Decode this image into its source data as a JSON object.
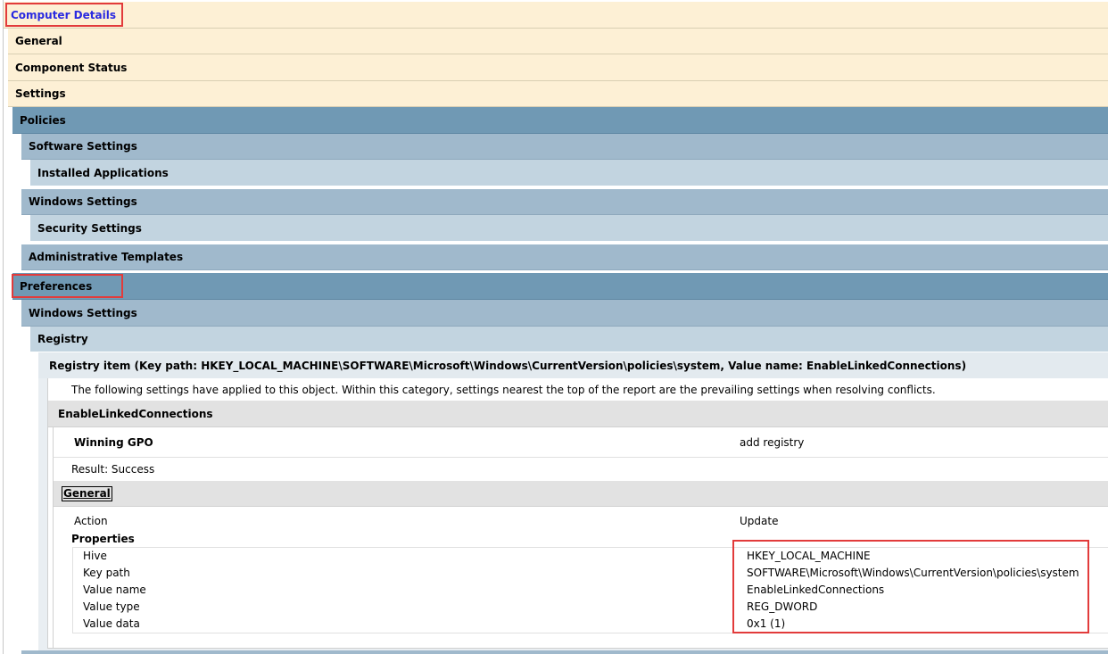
{
  "header": {
    "title": "Computer Details"
  },
  "sections": {
    "general": "General",
    "component_status": "Component Status",
    "settings": "Settings",
    "policies": "Policies",
    "software_settings": "Software Settings",
    "installed_applications": "Installed Applications",
    "windows_settings": "Windows Settings",
    "security_settings": "Security Settings",
    "administrative_templates": "Administrative Templates",
    "preferences": "Preferences",
    "pref_windows_settings": "Windows Settings",
    "registry": "Registry",
    "registry_item": "Registry item (Key path: HKEY_LOCAL_MACHINE\\SOFTWARE\\Microsoft\\Windows\\CurrentVersion\\policies\\system, Value name: EnableLinkedConnections)"
  },
  "detail": {
    "note": "The following settings have applied to this object. Within this category, settings nearest the top of the report are the prevailing settings when resolving conflicts.",
    "item_name": "EnableLinkedConnections",
    "winning_gpo_label": "Winning GPO",
    "winning_gpo_value": "add registry",
    "result": "Result: Success",
    "general_link": "General",
    "action_label": "Action",
    "action_value": "Update",
    "properties_label": "Properties",
    "properties": [
      {
        "name": "Hive",
        "value": "HKEY_LOCAL_MACHINE"
      },
      {
        "name": "Key path",
        "value": "SOFTWARE\\Microsoft\\Windows\\CurrentVersion\\policies\\system"
      },
      {
        "name": "Value name",
        "value": "EnableLinkedConnections"
      },
      {
        "name": "Value type",
        "value": "REG_DWORD"
      },
      {
        "name": "Value data",
        "value": "0x1 (1)"
      }
    ]
  },
  "colors": {
    "tan": "#fdf0d5",
    "dark_blue": "#7099b4",
    "mid_blue": "#a0b9cc",
    "light_blue": "#c2d4e0",
    "highlight_red": "#e23b3b",
    "title_blue": "#2a2ae0"
  }
}
